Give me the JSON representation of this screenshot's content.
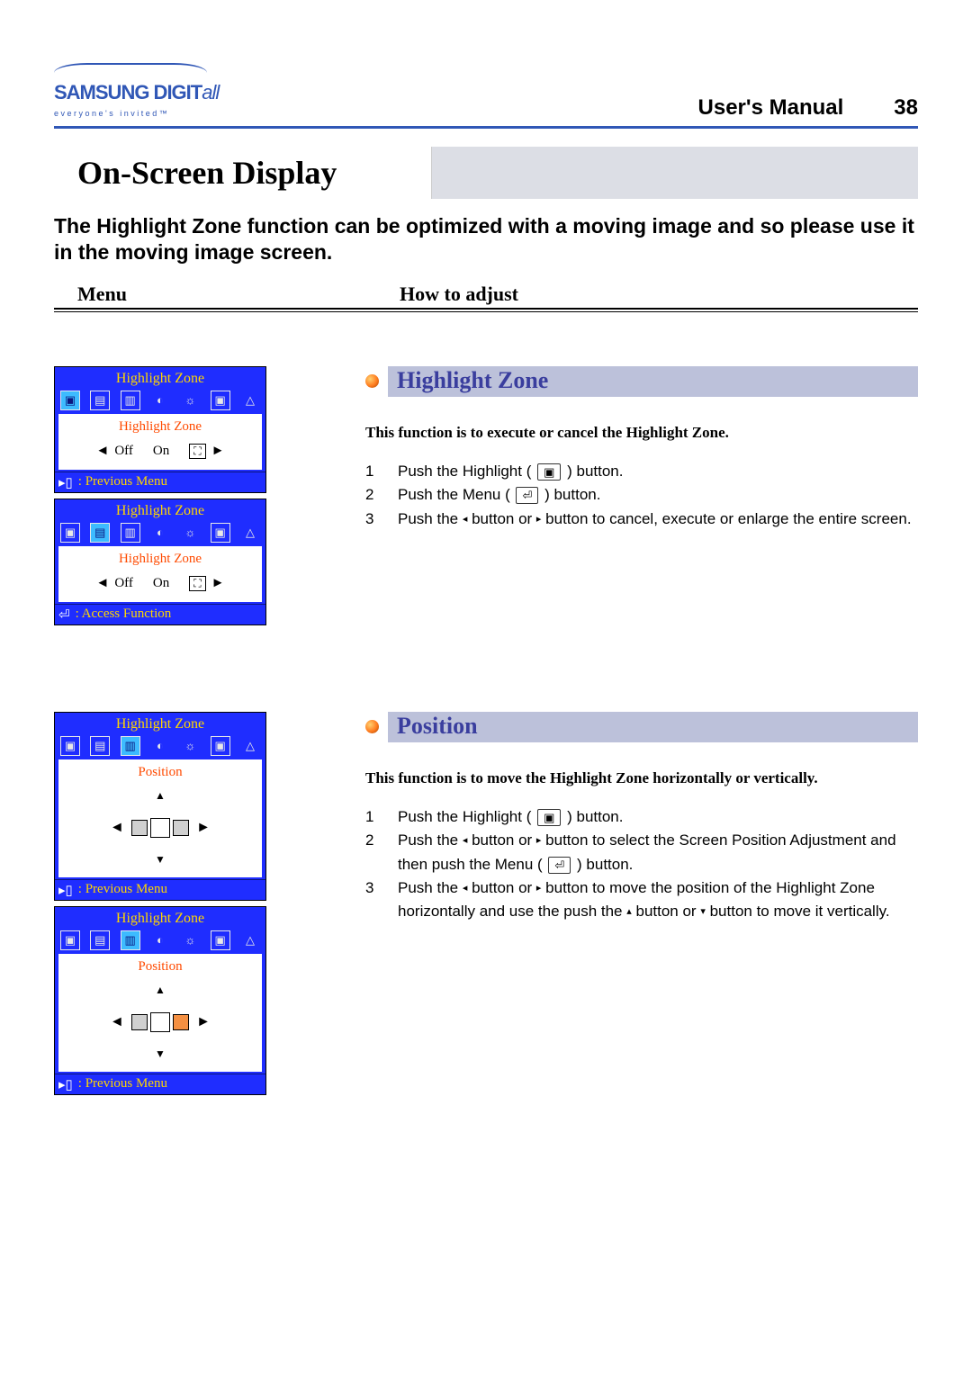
{
  "brand": {
    "main_a": "SAMSUNG DIGIT",
    "main_b": "all",
    "tag": "everyone's invited™"
  },
  "header": {
    "label": "User's Manual",
    "page": "38"
  },
  "title": "On-Screen Display",
  "intro": "The Highlight Zone function can be optimized with a moving image and so please use it in the moving image screen.",
  "cols": {
    "menu": "Menu",
    "howto": "How to adjust"
  },
  "osd_common": {
    "title": "Highlight Zone",
    "footer_prev": ": Previous Menu",
    "footer_access": ": Access Function"
  },
  "hz": {
    "sub_label": "Highlight Zone",
    "off": "Off",
    "on": "On"
  },
  "pos": {
    "sub_label": "Position"
  },
  "section_hz": {
    "heading": "Highlight Zone",
    "desc": "This function is to execute or cancel the Highlight Zone.",
    "steps": [
      "Push the Highlight (      ) button.",
      "Push the Menu (      ) button.",
      "Push the ◂ button or ▸ button to cancel, execute or enlarge the entire screen."
    ]
  },
  "section_pos": {
    "heading": "Position",
    "desc": "This function is to move the Highlight Zone horizontally or vertically.",
    "steps": [
      "Push the Highlight (      ) button.",
      "Push the ◂ button or ▸ button to select the Screen Position Adjustment and then push the Menu (      ) button.",
      "Push the ◂ button or ▸ button to move the position of the Highlight Zone horizontally and use the push the ▴ button or ▾ button to move it vertically."
    ]
  }
}
